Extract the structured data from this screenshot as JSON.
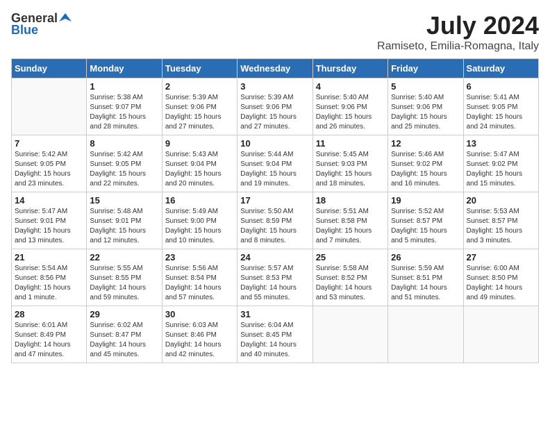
{
  "header": {
    "logo_general": "General",
    "logo_blue": "Blue",
    "title": "July 2024",
    "subtitle": "Ramiseto, Emilia-Romagna, Italy"
  },
  "days_of_week": [
    "Sunday",
    "Monday",
    "Tuesday",
    "Wednesday",
    "Thursday",
    "Friday",
    "Saturday"
  ],
  "weeks": [
    [
      {
        "day": "",
        "info": ""
      },
      {
        "day": "1",
        "info": "Sunrise: 5:38 AM\nSunset: 9:07 PM\nDaylight: 15 hours\nand 28 minutes."
      },
      {
        "day": "2",
        "info": "Sunrise: 5:39 AM\nSunset: 9:06 PM\nDaylight: 15 hours\nand 27 minutes."
      },
      {
        "day": "3",
        "info": "Sunrise: 5:39 AM\nSunset: 9:06 PM\nDaylight: 15 hours\nand 27 minutes."
      },
      {
        "day": "4",
        "info": "Sunrise: 5:40 AM\nSunset: 9:06 PM\nDaylight: 15 hours\nand 26 minutes."
      },
      {
        "day": "5",
        "info": "Sunrise: 5:40 AM\nSunset: 9:06 PM\nDaylight: 15 hours\nand 25 minutes."
      },
      {
        "day": "6",
        "info": "Sunrise: 5:41 AM\nSunset: 9:05 PM\nDaylight: 15 hours\nand 24 minutes."
      }
    ],
    [
      {
        "day": "7",
        "info": "Sunrise: 5:42 AM\nSunset: 9:05 PM\nDaylight: 15 hours\nand 23 minutes."
      },
      {
        "day": "8",
        "info": "Sunrise: 5:42 AM\nSunset: 9:05 PM\nDaylight: 15 hours\nand 22 minutes."
      },
      {
        "day": "9",
        "info": "Sunrise: 5:43 AM\nSunset: 9:04 PM\nDaylight: 15 hours\nand 20 minutes."
      },
      {
        "day": "10",
        "info": "Sunrise: 5:44 AM\nSunset: 9:04 PM\nDaylight: 15 hours\nand 19 minutes."
      },
      {
        "day": "11",
        "info": "Sunrise: 5:45 AM\nSunset: 9:03 PM\nDaylight: 15 hours\nand 18 minutes."
      },
      {
        "day": "12",
        "info": "Sunrise: 5:46 AM\nSunset: 9:02 PM\nDaylight: 15 hours\nand 16 minutes."
      },
      {
        "day": "13",
        "info": "Sunrise: 5:47 AM\nSunset: 9:02 PM\nDaylight: 15 hours\nand 15 minutes."
      }
    ],
    [
      {
        "day": "14",
        "info": "Sunrise: 5:47 AM\nSunset: 9:01 PM\nDaylight: 15 hours\nand 13 minutes."
      },
      {
        "day": "15",
        "info": "Sunrise: 5:48 AM\nSunset: 9:01 PM\nDaylight: 15 hours\nand 12 minutes."
      },
      {
        "day": "16",
        "info": "Sunrise: 5:49 AM\nSunset: 9:00 PM\nDaylight: 15 hours\nand 10 minutes."
      },
      {
        "day": "17",
        "info": "Sunrise: 5:50 AM\nSunset: 8:59 PM\nDaylight: 15 hours\nand 8 minutes."
      },
      {
        "day": "18",
        "info": "Sunrise: 5:51 AM\nSunset: 8:58 PM\nDaylight: 15 hours\nand 7 minutes."
      },
      {
        "day": "19",
        "info": "Sunrise: 5:52 AM\nSunset: 8:57 PM\nDaylight: 15 hours\nand 5 minutes."
      },
      {
        "day": "20",
        "info": "Sunrise: 5:53 AM\nSunset: 8:57 PM\nDaylight: 15 hours\nand 3 minutes."
      }
    ],
    [
      {
        "day": "21",
        "info": "Sunrise: 5:54 AM\nSunset: 8:56 PM\nDaylight: 15 hours\nand 1 minute."
      },
      {
        "day": "22",
        "info": "Sunrise: 5:55 AM\nSunset: 8:55 PM\nDaylight: 14 hours\nand 59 minutes."
      },
      {
        "day": "23",
        "info": "Sunrise: 5:56 AM\nSunset: 8:54 PM\nDaylight: 14 hours\nand 57 minutes."
      },
      {
        "day": "24",
        "info": "Sunrise: 5:57 AM\nSunset: 8:53 PM\nDaylight: 14 hours\nand 55 minutes."
      },
      {
        "day": "25",
        "info": "Sunrise: 5:58 AM\nSunset: 8:52 PM\nDaylight: 14 hours\nand 53 minutes."
      },
      {
        "day": "26",
        "info": "Sunrise: 5:59 AM\nSunset: 8:51 PM\nDaylight: 14 hours\nand 51 minutes."
      },
      {
        "day": "27",
        "info": "Sunrise: 6:00 AM\nSunset: 8:50 PM\nDaylight: 14 hours\nand 49 minutes."
      }
    ],
    [
      {
        "day": "28",
        "info": "Sunrise: 6:01 AM\nSunset: 8:49 PM\nDaylight: 14 hours\nand 47 minutes."
      },
      {
        "day": "29",
        "info": "Sunrise: 6:02 AM\nSunset: 8:47 PM\nDaylight: 14 hours\nand 45 minutes."
      },
      {
        "day": "30",
        "info": "Sunrise: 6:03 AM\nSunset: 8:46 PM\nDaylight: 14 hours\nand 42 minutes."
      },
      {
        "day": "31",
        "info": "Sunrise: 6:04 AM\nSunset: 8:45 PM\nDaylight: 14 hours\nand 40 minutes."
      },
      {
        "day": "",
        "info": ""
      },
      {
        "day": "",
        "info": ""
      },
      {
        "day": "",
        "info": ""
      }
    ]
  ]
}
